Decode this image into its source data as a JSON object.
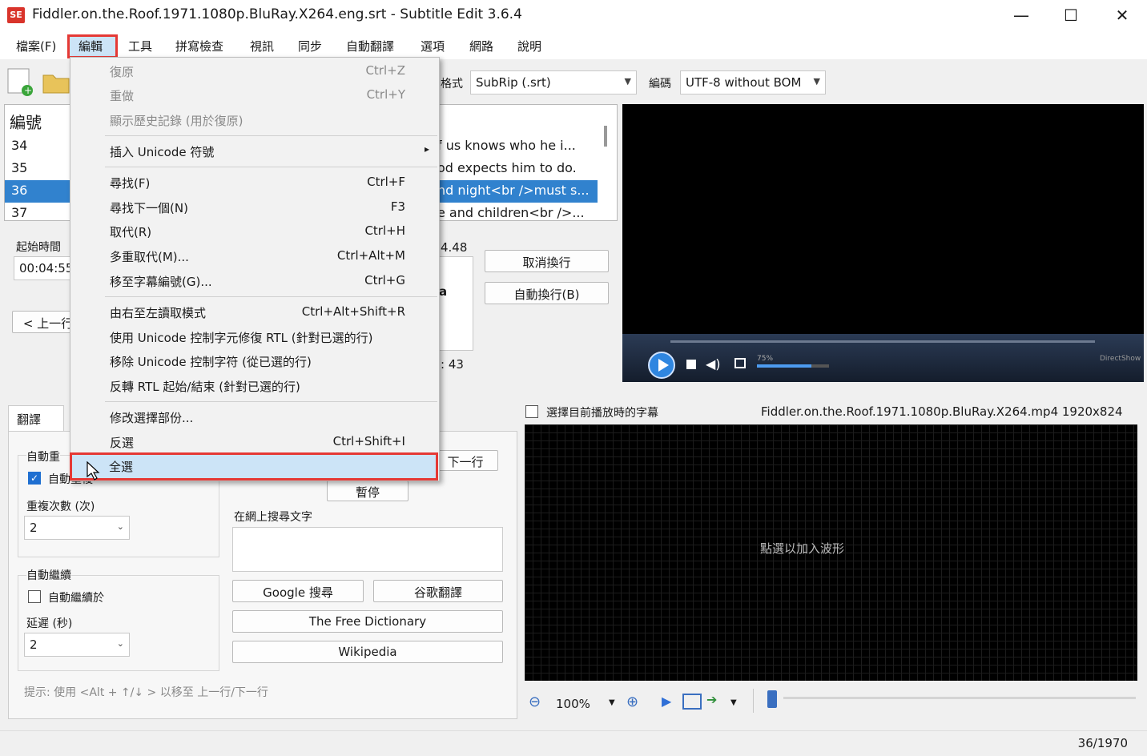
{
  "window": {
    "title": "Fiddler.on.the.Roof.1971.1080p.BluRay.X264.eng.srt - Subtitle Edit 3.6.4",
    "icon_text": "SE",
    "minimize": "—",
    "maximize": "☐",
    "close": "✕"
  },
  "menubar": {
    "items": [
      "檔案(F)",
      "編輯",
      "工具",
      "拼寫檢查",
      "視訊",
      "同步",
      "自動翻譯",
      "選項",
      "網路",
      "說明"
    ]
  },
  "toolbar": {
    "format_label": "格式",
    "format_value": "SubRip (.srt)",
    "encoding_label": "編碼",
    "encoding_value": "UTF-8 without BOM"
  },
  "sublist": {
    "header_number": "編號",
    "rows": [
      {
        "num": "34",
        "text": "f us knows who he i..."
      },
      {
        "num": "35",
        "text": "od expects him to do."
      },
      {
        "num": "36",
        "text": "nd night<br />must s..."
      },
      {
        "num": "37",
        "text": "e and children<br />..."
      }
    ]
  },
  "editpanel": {
    "start_time_label": "起始時間",
    "start_time_value": "00:04:55",
    "duration_fragment": "4.48",
    "chars_fragment": ": 43",
    "prev_button": "< 上一行",
    "unbreak_button": "取消換行",
    "autobreak_button": "自動換行(B)",
    "text_fragment": "a"
  },
  "menu": {
    "items": [
      {
        "label": "復原",
        "shortcut": "Ctrl+Z",
        "disabled": true
      },
      {
        "label": "重做",
        "shortcut": "Ctrl+Y",
        "disabled": true
      },
      {
        "label": "顯示歷史記錄 (用於復原)",
        "shortcut": "",
        "disabled": true
      },
      {
        "label": "插入 Unicode 符號",
        "shortcut": "▸",
        "disabled": false
      },
      {
        "label": "尋找(F)",
        "shortcut": "Ctrl+F",
        "disabled": false
      },
      {
        "label": "尋找下一個(N)",
        "shortcut": "F3",
        "disabled": false
      },
      {
        "label": "取代(R)",
        "shortcut": "Ctrl+H",
        "disabled": false
      },
      {
        "label": "多重取代(M)...",
        "shortcut": "Ctrl+Alt+M",
        "disabled": false
      },
      {
        "label": "移至字幕編號(G)...",
        "shortcut": "Ctrl+G",
        "disabled": false
      },
      {
        "label": "由右至左讀取模式",
        "shortcut": "Ctrl+Alt+Shift+R",
        "disabled": false
      },
      {
        "label": "使用 Unicode 控制字元修復 RTL (針對已選的行)",
        "shortcut": "",
        "disabled": false
      },
      {
        "label": "移除 Unicode 控制字符 (從已選的行)",
        "shortcut": "",
        "disabled": false
      },
      {
        "label": "反轉 RTL 起始/結束 (針對已選的行)",
        "shortcut": "",
        "disabled": false
      },
      {
        "label": "修改選擇部份...",
        "shortcut": "",
        "disabled": false
      },
      {
        "label": "反選",
        "shortcut": "Ctrl+Shift+I",
        "disabled": false
      },
      {
        "label": "全選",
        "shortcut": "",
        "disabled": false
      }
    ]
  },
  "translate": {
    "tab_label": "翻譯",
    "auto_repeat_label": "自動重",
    "auto_repeat_check": "自動重複",
    "repeat_count_label": "重複次數 (次)",
    "repeat_count_value": "2",
    "auto_continue_label": "自動繼續",
    "auto_continue_check": "自動繼續於",
    "delay_label": "延遲 (秒)",
    "delay_value": "2",
    "next_line_button": "下一行",
    "pause_button": "暫停",
    "search_web_label": "在網上搜尋文字",
    "google_search_button": "Google 搜尋",
    "google_translate_button": "谷歌翻譯",
    "free_dictionary_button": "The Free Dictionary",
    "wikipedia_button": "Wikipedia",
    "hint": "提示: 使用 <Alt + ↑/↓ > 以移至 上一行/下一行"
  },
  "waveform": {
    "select_current_label": "選擇目前播放時的字幕",
    "video_info": "Fiddler.on.the.Roof.1971.1080p.BluRay.X264.mp4 1920x824",
    "click_to_add": "點選以加入波形",
    "zoom_value": "100%"
  },
  "video": {
    "volume_label": "75%",
    "brand": "DirectShow"
  },
  "status": {
    "position": "36/1970"
  }
}
